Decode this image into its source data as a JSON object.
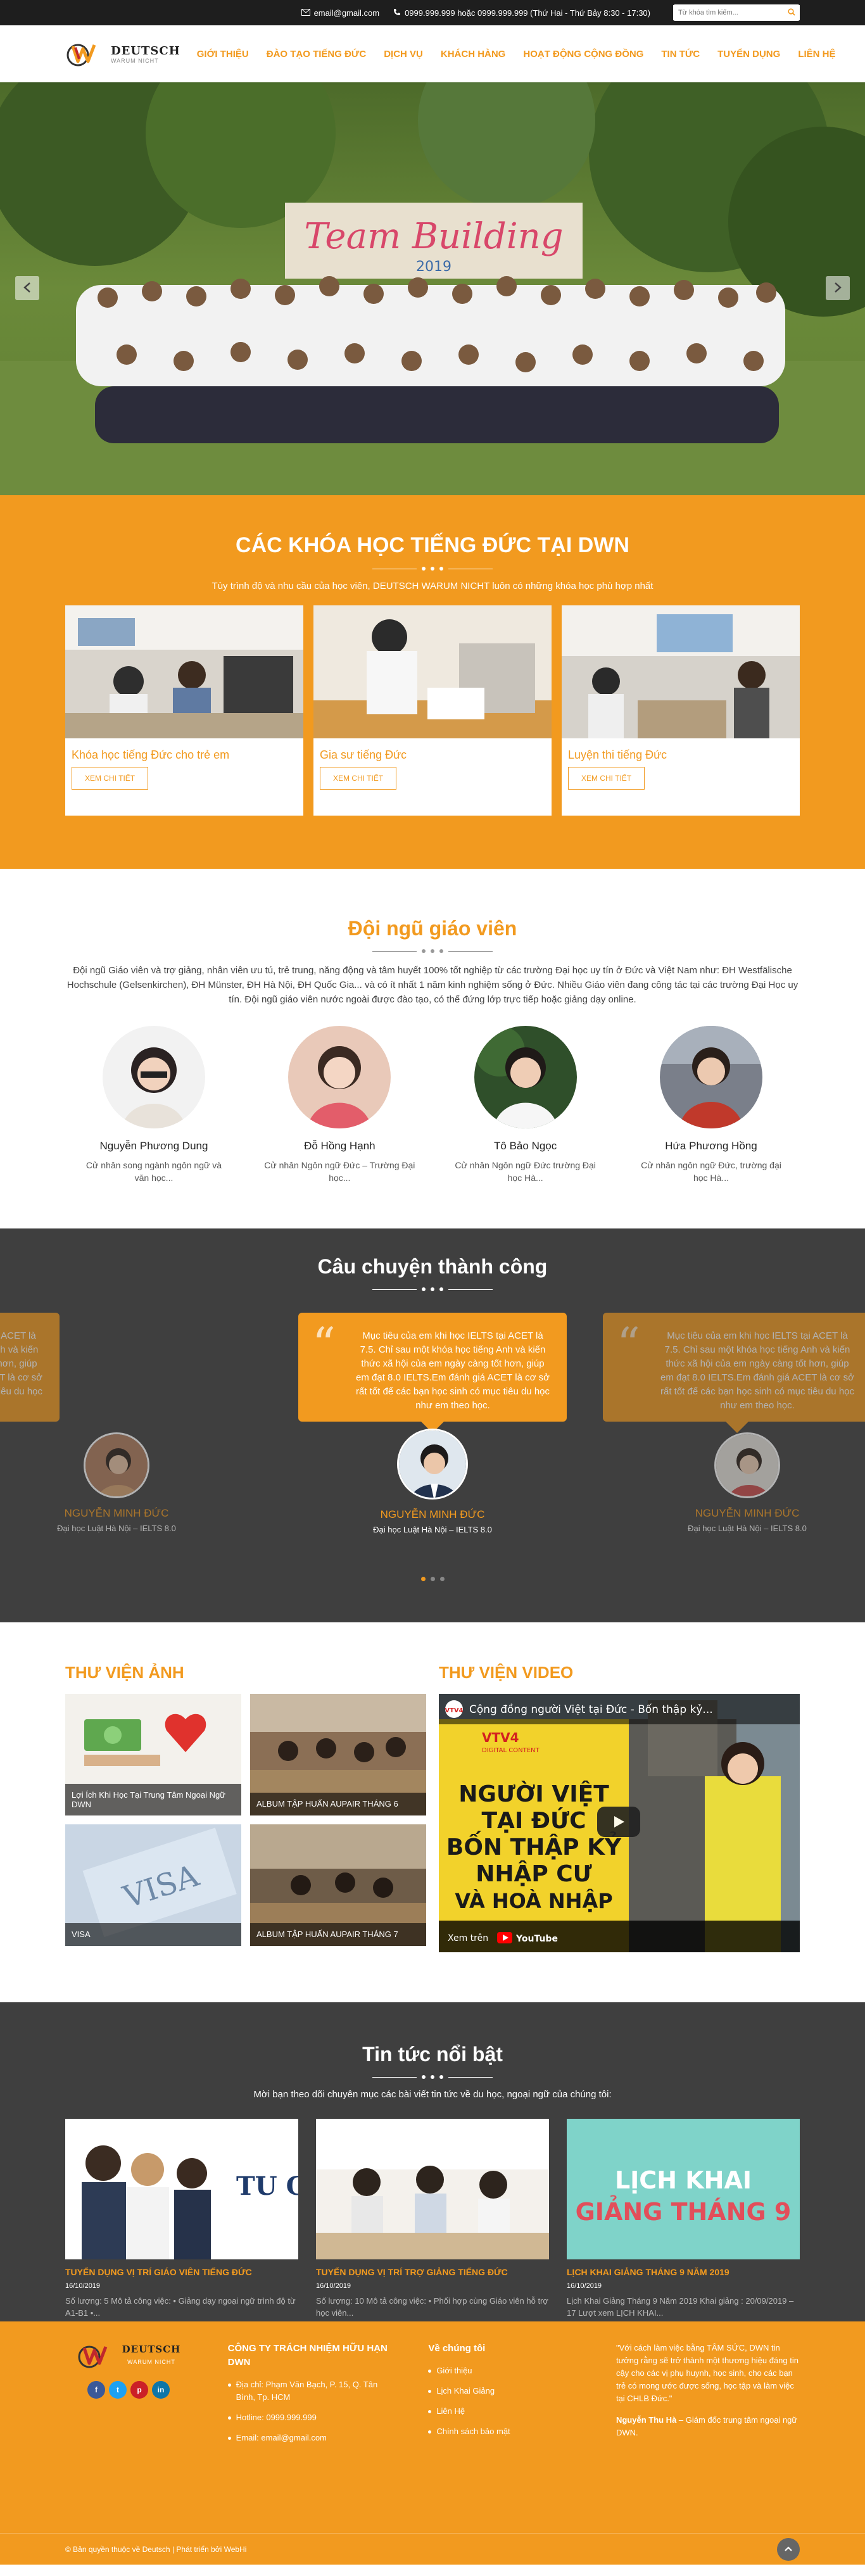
{
  "topbar": {
    "email": "email@gmail.com",
    "phone": "0999.999.999 hoặc 0999.999.999 (Thứ Hai - Thứ Bảy 8:30 - 17:30)",
    "search_placeholder": "Từ khóa tìm kiếm..."
  },
  "logo": {
    "name": "DEUTSCH",
    "tagline": "WARUM NICHT"
  },
  "nav": [
    "GIỚI THIỆU",
    "ĐÀO TẠO TIẾNG ĐỨC",
    "DỊCH VỤ",
    "KHÁCH HÀNG",
    "HOẠT ĐỘNG CỘNG ĐỒNG",
    "TIN TỨC",
    "TUYỂN DỤNG",
    "LIÊN HỆ"
  ],
  "hero": {
    "banner_text": "Team Building",
    "banner_year": "2019"
  },
  "courses": {
    "title": "CÁC KHÓA HỌC TIẾNG ĐỨC TẠI DWN",
    "subtitle": "Tùy trình độ và nhu cầu của học viên, DEUTSCH WARUM NICHT luôn có những khóa học phù hợp nhất",
    "items": [
      {
        "name": "Khóa học tiếng Đức cho trẻ em",
        "button": "XEM CHI TIẾT"
      },
      {
        "name": "Gia sư tiếng Đức",
        "button": "XEM CHI TIẾT"
      },
      {
        "name": "Luyện thi tiếng Đức",
        "button": "XEM CHI TIẾT"
      }
    ]
  },
  "team": {
    "title": "Đội ngũ giáo viên",
    "intro": "Đội ngũ Giáo viên và trợ giảng, nhân viên ưu tú, trẻ trung, năng động và tâm huyết 100% tốt nghiệp từ các trường Đại học uy tín ở Đức và Việt Nam như: ĐH Westfälische Hochschule (Gelsenkirchen), ĐH Münster, ĐH Hà Nội, ĐH Quốc Gia... và có ít nhất 1 năm kinh nghiệm sống ở Đức. Nhiều Giáo viên đang công tác tại các trường Đại Học uy tín. Đội ngũ giáo viên nước ngoài được đào tạo, có thể đứng lớp trực tiếp hoặc giảng dạy online.",
    "members": [
      {
        "name": "Nguyễn Phương Dung",
        "desc": "Cử nhân song ngành ngôn ngữ và văn học..."
      },
      {
        "name": "Đỗ Hồng Hạnh",
        "desc": "Cử nhân Ngôn ngữ Đức – Trường Đại học..."
      },
      {
        "name": "Tô Bảo Ngọc",
        "desc": "Cử nhân Ngôn ngữ Đức trường Đại học Hà..."
      },
      {
        "name": "Hứa Phương Hồng",
        "desc": "Cử nhân ngôn ngữ Đức, trường đại học Hà..."
      }
    ]
  },
  "stories": {
    "title": "Câu chuyện thành công",
    "quote": "Mục tiêu của em khi học IELTS tại ACET là 7.5. Chỉ sau một khóa học tiếng Anh và kiến thức xã hội của em ngày càng tốt hơn, giúp em đạt 8.0 IELTS.Em đánh giá ACET là cơ sở rất tốt để các bạn học sinh có mục tiêu du học như em theo học.",
    "people": [
      {
        "name": "NGUYỄN MINH ĐỨC",
        "desc": "Đại học Luật Hà Nội – IELTS 8.0"
      },
      {
        "name": "NGUYỄN MINH ĐỨC",
        "desc": "Đại học Luật Hà Nội – IELTS 8.0"
      },
      {
        "name": "NGUYỄN MINH ĐỨC",
        "desc": "Đại học Luật Hà Nội – IELTS 8.0"
      }
    ]
  },
  "gallery": {
    "photos_title": "THƯ VIỆN ẢNH",
    "video_title": "THƯ VIỆN VIDEO",
    "albums": [
      "Lợi Ích Khi Học Tại Trung Tâm Ngoại Ngữ DWN",
      "ALBUM TẬP HUẤN AUPAIR THÁNG 6",
      "VISA",
      "ALBUM TẬP HUẤN AUPAIR THÁNG 7"
    ],
    "video": {
      "title": "Cộng đồng người Việt tại Đức - Bốn thập kỷ...",
      "channel": "VTV4",
      "channel_sub": "DIGITAL CONTENT",
      "overlay": [
        "NGƯỜI VIỆT",
        "TẠI ĐỨC",
        "BỐN THẬP KỶ",
        "NHẬP CƯ",
        "VÀ HOÀ NHẬP"
      ],
      "watch_on": "Xem trên",
      "platform": "YouTube"
    }
  },
  "news": {
    "title": "Tin tức nổi bật",
    "subtitle": "Mời bạn theo dõi chuyên mục các bài viết tin tức về du học, ngoại ngữ của chúng tôi:",
    "items": [
      {
        "title": "TUYỂN DỤNG VỊ TRÍ GIÁO VIÊN TIẾNG ĐỨC",
        "date": "16/10/2019",
        "excerpt": "Số lượng: 5 Mô tả công việc: • Giảng dạy ngoại ngữ trình độ từ A1-B1 •...",
        "image_text": "TU G"
      },
      {
        "title": "TUYỂN DỤNG VỊ TRÍ TRỢ GIẢNG TIẾNG ĐỨC",
        "date": "16/10/2019",
        "excerpt": "Số lượng: 10 Mô tả công việc: • Phối hợp cùng Giáo viên hỗ trợ học viên...",
        "image_text": ""
      },
      {
        "title": "LỊCH KHAI GIẢNG THÁNG 9 NĂM 2019",
        "date": "16/10/2019",
        "excerpt": "Lịch Khai Giảng Tháng 9 Năm 2019 Khai giảng : 20/09/2019 – 17 Lượt xem LỊCH KHAI...",
        "image_text": [
          "LỊCH KHAI",
          "GIẢNG THÁNG 9"
        ]
      }
    ]
  },
  "footer": {
    "company": "CÔNG TY TRÁCH NHIỆM HỮU HẠN DWN",
    "address": "Địa chỉ: Phạm Văn Bạch, P. 15, Q. Tân Bình, Tp. HCM",
    "hotline": "Hotline: 0999.999.999",
    "email": "Email: email@gmail.com",
    "about_title": "Về chúng tôi",
    "links": [
      "Giới thiệu",
      "Lịch Khai Giảng",
      "Liên Hệ",
      "Chính sách bảo mật"
    ],
    "testimonial": "\"Với cách làm việc bằng TÂM SỨC, DWN tin tưởng rằng sẽ trở thành một thương hiệu đáng tin cậy cho  các vị phụ huynh, học sinh, cho các bạn trẻ có mong ước được sống, học tập và làm việc tại CHLB Đức.\"",
    "signer": "Nguyễn Thu Hà",
    "signer_role": " – Giám đốc trung tâm ngoại ngữ DWN.",
    "socials": [
      "f",
      "t",
      "p",
      "in"
    ],
    "copyright": "© Bản quyền thuộc về Deutsch | Phát triển bởi WebHi"
  },
  "colors": {
    "accent": "#f29a1f",
    "dark": "#3f3f3f",
    "topbar": "#1e1e1e"
  }
}
